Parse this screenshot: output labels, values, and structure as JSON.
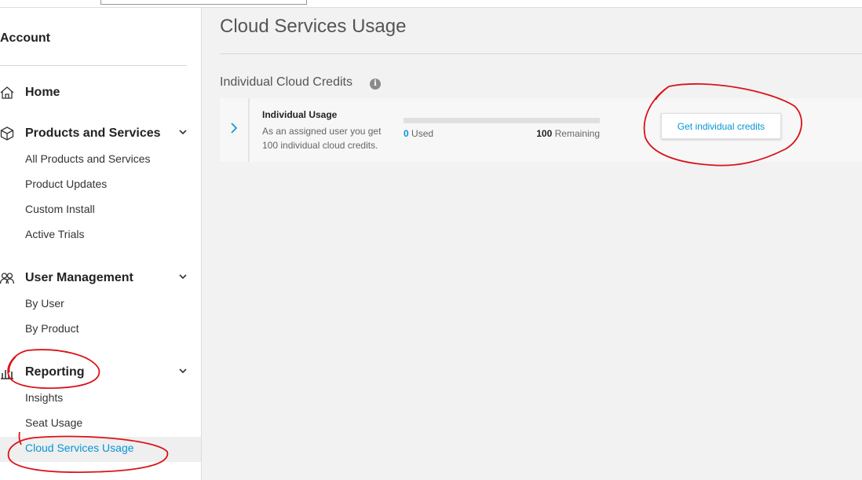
{
  "sidebar": {
    "account_label": "Account",
    "sections": [
      {
        "label": "Home",
        "icon": "home-icon"
      },
      {
        "label": "Products and Services",
        "icon": "cube-icon",
        "items": [
          "All Products and Services",
          "Product Updates",
          "Custom Install",
          "Active Trials"
        ]
      },
      {
        "label": "User Management",
        "icon": "users-icon",
        "items": [
          "By User",
          "By Product"
        ]
      },
      {
        "label": "Reporting",
        "icon": "bar-chart-icon",
        "items": [
          "Insights",
          "Seat Usage",
          "Cloud Services Usage"
        ],
        "active_item": "Cloud Services Usage"
      }
    ]
  },
  "main": {
    "title": "Cloud Services Usage",
    "section_title": "Individual Cloud Credits",
    "info_icon": "info-icon",
    "card": {
      "title": "Individual Usage",
      "description": "As an assigned user you get 100 individual cloud credits.",
      "used_value": "0",
      "used_label": "Used",
      "remaining_value": "100",
      "remaining_label": "Remaining",
      "used_fraction": 0,
      "button_label": "Get individual credits"
    }
  },
  "colors": {
    "accent": "#0696d7",
    "annotation": "#d9141a"
  }
}
